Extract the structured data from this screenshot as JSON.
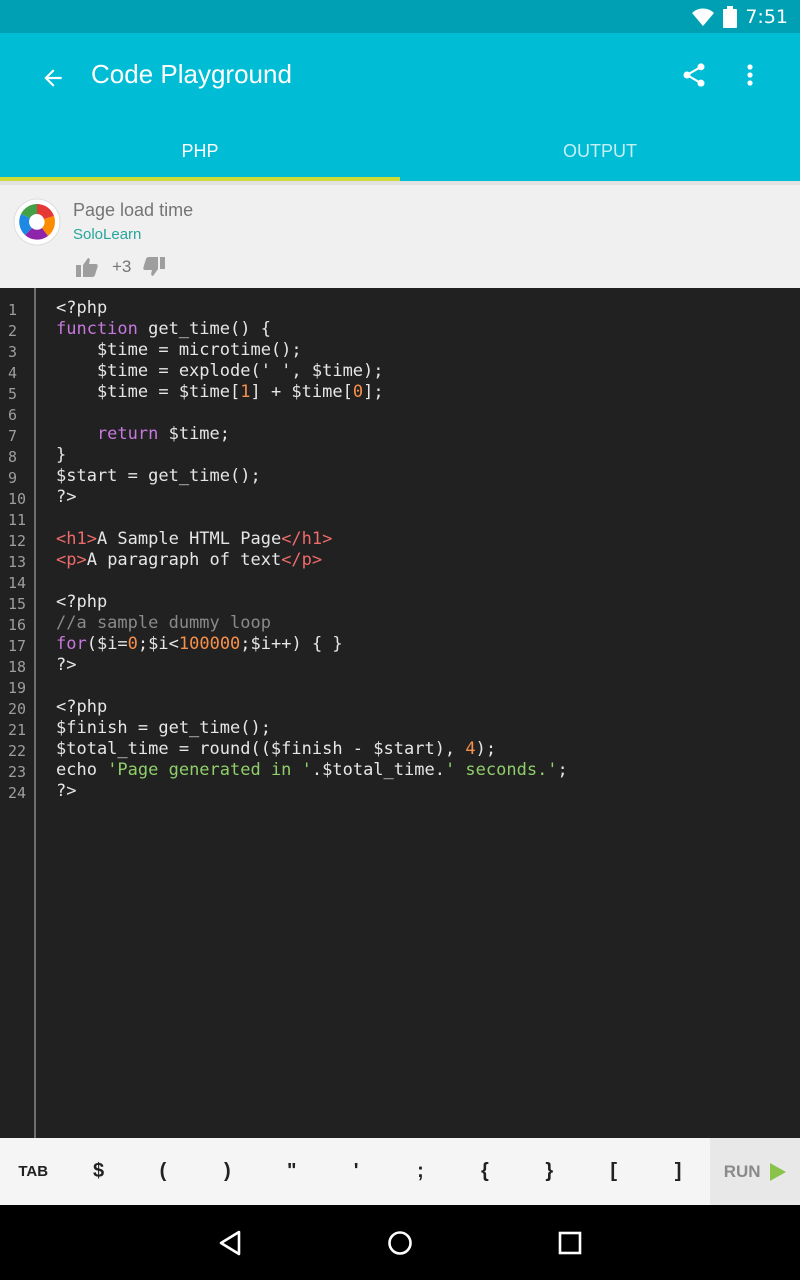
{
  "status_bar": {
    "time": "7:51",
    "icons": [
      "wifi-icon",
      "battery-icon"
    ]
  },
  "app_bar": {
    "title": "Code Playground",
    "icons": [
      "back-arrow-icon",
      "share-icon",
      "more-vert-icon"
    ],
    "background": "#00bcd4",
    "tabs": [
      {
        "label": "PHP",
        "active": true
      },
      {
        "label": "OUTPUT",
        "active": false
      }
    ],
    "tab_indicator_color": "#cddc39"
  },
  "header": {
    "code_title": "Page load time",
    "author": "SoloLearn",
    "votes": "+3",
    "author_color": "#26a69a"
  },
  "editor": {
    "line_numbers": [
      "1",
      "2",
      "3",
      "4",
      "5",
      "6",
      "7",
      "8",
      "9",
      "10",
      "11",
      "12",
      "13",
      "14",
      "15",
      "16",
      "17",
      "18",
      "19",
      "20",
      "21",
      "22",
      "23",
      "24"
    ],
    "lines": [
      [
        {
          "t": "p",
          "v": "<?php"
        }
      ],
      [
        {
          "t": "kw",
          "v": "function"
        },
        {
          "t": "p",
          "v": " get_time() {"
        }
      ],
      [
        {
          "t": "p",
          "v": "    $time = microtime();"
        }
      ],
      [
        {
          "t": "p",
          "v": "    $time = explode(' ', $time);"
        }
      ],
      [
        {
          "t": "p",
          "v": "    $time = $time["
        },
        {
          "t": "num",
          "v": "1"
        },
        {
          "t": "p",
          "v": "] + $time["
        },
        {
          "t": "num",
          "v": "0"
        },
        {
          "t": "p",
          "v": "];"
        }
      ],
      [],
      [
        {
          "t": "kw",
          "v": "    return"
        },
        {
          "t": "p",
          "v": " $time;"
        }
      ],
      [
        {
          "t": "p",
          "v": "}"
        }
      ],
      [
        {
          "t": "p",
          "v": "$start = get_time();"
        }
      ],
      [
        {
          "t": "p",
          "v": "?>"
        }
      ],
      [],
      [
        {
          "t": "tag",
          "v": "<h1>"
        },
        {
          "t": "p",
          "v": "A Sample HTML Page"
        },
        {
          "t": "tag",
          "v": "</h1>"
        }
      ],
      [
        {
          "t": "tag",
          "v": "<p>"
        },
        {
          "t": "p",
          "v": "A paragraph of text"
        },
        {
          "t": "tag",
          "v": "</p>"
        }
      ],
      [],
      [
        {
          "t": "p",
          "v": "<?php"
        }
      ],
      [
        {
          "t": "cmt",
          "v": "//a sample dummy loop"
        }
      ],
      [
        {
          "t": "kw",
          "v": "for"
        },
        {
          "t": "p",
          "v": "($i="
        },
        {
          "t": "num",
          "v": "0"
        },
        {
          "t": "p",
          "v": ";$i<"
        },
        {
          "t": "num",
          "v": "100000"
        },
        {
          "t": "p",
          "v": ";$i++) { }"
        }
      ],
      [
        {
          "t": "p",
          "v": "?>"
        }
      ],
      [],
      [
        {
          "t": "p",
          "v": "<?php"
        }
      ],
      [
        {
          "t": "p",
          "v": "$finish = get_time();"
        }
      ],
      [
        {
          "t": "p",
          "v": "$total_time = round(($finish - $start), "
        },
        {
          "t": "num",
          "v": "4"
        },
        {
          "t": "p",
          "v": ");"
        }
      ],
      [
        {
          "t": "p",
          "v": "echo "
        },
        {
          "t": "str",
          "v": "'Page generated in '"
        },
        {
          "t": "p",
          "v": ".$total_time."
        },
        {
          "t": "str",
          "v": "' seconds.'"
        },
        {
          "t": "p",
          "v": ";"
        }
      ],
      [
        {
          "t": "p",
          "v": "?>"
        }
      ]
    ]
  },
  "key_bar": {
    "tab_label": "TAB",
    "keys": [
      "$",
      "(",
      ")",
      "\"",
      "'",
      ";",
      "{",
      "}",
      "[",
      "]"
    ],
    "run_label": "RUN",
    "run_icon": "play-icon",
    "run_icon_color": "#8bc34a"
  },
  "nav_bar": {
    "icons": [
      "nav-back-icon",
      "nav-home-icon",
      "nav-recents-icon"
    ]
  }
}
